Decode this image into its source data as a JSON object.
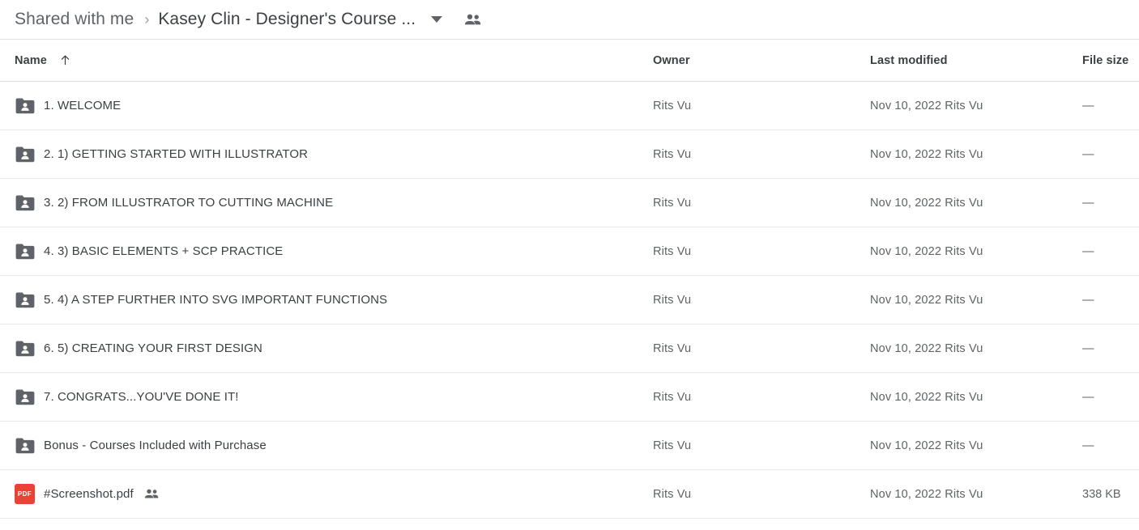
{
  "breadcrumb": {
    "parent": "Shared with me",
    "separator": "›",
    "current": "Kasey Clin - Designer's Course ...",
    "caret_icon": "chevron-down-icon",
    "people_icon": "people-icon"
  },
  "table": {
    "columns": {
      "name": "Name",
      "owner": "Owner",
      "modified": "Last modified",
      "size": "File size"
    },
    "sort": {
      "column": "Name",
      "direction": "asc",
      "icon": "arrow-up-icon"
    },
    "rows": [
      {
        "icon": "shared-folder-icon",
        "type": "folder",
        "name": "1. WELCOME",
        "owner": "Rits Vu",
        "modified": "Nov 10, 2022 Rits Vu",
        "size": "—",
        "shared": false
      },
      {
        "icon": "shared-folder-icon",
        "type": "folder",
        "name": "2. 1) GETTING STARTED WITH ILLUSTRATOR",
        "owner": "Rits Vu",
        "modified": "Nov 10, 2022 Rits Vu",
        "size": "—",
        "shared": false
      },
      {
        "icon": "shared-folder-icon",
        "type": "folder",
        "name": "3. 2) FROM ILLUSTRATOR TO CUTTING MACHINE",
        "owner": "Rits Vu",
        "modified": "Nov 10, 2022 Rits Vu",
        "size": "—",
        "shared": false
      },
      {
        "icon": "shared-folder-icon",
        "type": "folder",
        "name": "4. 3) BASIC ELEMENTS + SCP PRACTICE",
        "owner": "Rits Vu",
        "modified": "Nov 10, 2022 Rits Vu",
        "size": "—",
        "shared": false
      },
      {
        "icon": "shared-folder-icon",
        "type": "folder",
        "name": "5. 4) A STEP FURTHER INTO SVG IMPORTANT FUNCTIONS",
        "owner": "Rits Vu",
        "modified": "Nov 10, 2022 Rits Vu",
        "size": "—",
        "shared": false
      },
      {
        "icon": "shared-folder-icon",
        "type": "folder",
        "name": "6. 5) CREATING YOUR FIRST DESIGN",
        "owner": "Rits Vu",
        "modified": "Nov 10, 2022 Rits Vu",
        "size": "—",
        "shared": false
      },
      {
        "icon": "shared-folder-icon",
        "type": "folder",
        "name": "7. CONGRATS...YOU'VE DONE IT!",
        "owner": "Rits Vu",
        "modified": "Nov 10, 2022 Rits Vu",
        "size": "—",
        "shared": false
      },
      {
        "icon": "shared-folder-icon",
        "type": "folder",
        "name": "Bonus - Courses Included with Purchase",
        "owner": "Rits Vu",
        "modified": "Nov 10, 2022 Rits Vu",
        "size": "—",
        "shared": false
      },
      {
        "icon": "pdf-file-icon",
        "type": "pdf",
        "icon_label": "PDF",
        "name": "#Screenshot.pdf",
        "owner": "Rits Vu",
        "modified": "Nov 10, 2022 Rits Vu",
        "size": "338 KB",
        "shared": true
      }
    ]
  },
  "colors": {
    "pdf_red": "#ea4335",
    "folder_gray": "#5f6368",
    "text_primary": "#3c4043",
    "text_secondary": "#5f6368",
    "divider": "#e8eaed"
  }
}
